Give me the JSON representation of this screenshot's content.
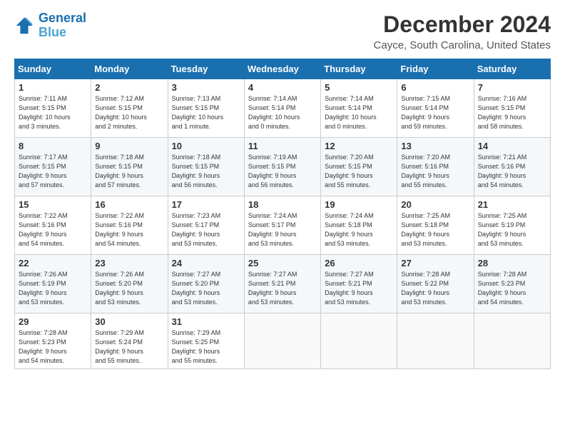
{
  "header": {
    "logo_line1": "General",
    "logo_line2": "Blue",
    "title": "December 2024",
    "subtitle": "Cayce, South Carolina, United States"
  },
  "days_of_week": [
    "Sunday",
    "Monday",
    "Tuesday",
    "Wednesday",
    "Thursday",
    "Friday",
    "Saturday"
  ],
  "weeks": [
    [
      {
        "day": "1",
        "lines": [
          "Sunrise: 7:11 AM",
          "Sunset: 5:15 PM",
          "Daylight: 10 hours",
          "and 3 minutes."
        ]
      },
      {
        "day": "2",
        "lines": [
          "Sunrise: 7:12 AM",
          "Sunset: 5:15 PM",
          "Daylight: 10 hours",
          "and 2 minutes."
        ]
      },
      {
        "day": "3",
        "lines": [
          "Sunrise: 7:13 AM",
          "Sunset: 5:15 PM",
          "Daylight: 10 hours",
          "and 1 minute."
        ]
      },
      {
        "day": "4",
        "lines": [
          "Sunrise: 7:14 AM",
          "Sunset: 5:14 PM",
          "Daylight: 10 hours",
          "and 0 minutes."
        ]
      },
      {
        "day": "5",
        "lines": [
          "Sunrise: 7:14 AM",
          "Sunset: 5:14 PM",
          "Daylight: 10 hours",
          "and 0 minutes."
        ]
      },
      {
        "day": "6",
        "lines": [
          "Sunrise: 7:15 AM",
          "Sunset: 5:14 PM",
          "Daylight: 9 hours",
          "and 59 minutes."
        ]
      },
      {
        "day": "7",
        "lines": [
          "Sunrise: 7:16 AM",
          "Sunset: 5:15 PM",
          "Daylight: 9 hours",
          "and 58 minutes."
        ]
      }
    ],
    [
      {
        "day": "8",
        "lines": [
          "Sunrise: 7:17 AM",
          "Sunset: 5:15 PM",
          "Daylight: 9 hours",
          "and 57 minutes."
        ]
      },
      {
        "day": "9",
        "lines": [
          "Sunrise: 7:18 AM",
          "Sunset: 5:15 PM",
          "Daylight: 9 hours",
          "and 57 minutes."
        ]
      },
      {
        "day": "10",
        "lines": [
          "Sunrise: 7:18 AM",
          "Sunset: 5:15 PM",
          "Daylight: 9 hours",
          "and 56 minutes."
        ]
      },
      {
        "day": "11",
        "lines": [
          "Sunrise: 7:19 AM",
          "Sunset: 5:15 PM",
          "Daylight: 9 hours",
          "and 56 minutes."
        ]
      },
      {
        "day": "12",
        "lines": [
          "Sunrise: 7:20 AM",
          "Sunset: 5:15 PM",
          "Daylight: 9 hours",
          "and 55 minutes."
        ]
      },
      {
        "day": "13",
        "lines": [
          "Sunrise: 7:20 AM",
          "Sunset: 5:16 PM",
          "Daylight: 9 hours",
          "and 55 minutes."
        ]
      },
      {
        "day": "14",
        "lines": [
          "Sunrise: 7:21 AM",
          "Sunset: 5:16 PM",
          "Daylight: 9 hours",
          "and 54 minutes."
        ]
      }
    ],
    [
      {
        "day": "15",
        "lines": [
          "Sunrise: 7:22 AM",
          "Sunset: 5:16 PM",
          "Daylight: 9 hours",
          "and 54 minutes."
        ]
      },
      {
        "day": "16",
        "lines": [
          "Sunrise: 7:22 AM",
          "Sunset: 5:16 PM",
          "Daylight: 9 hours",
          "and 54 minutes."
        ]
      },
      {
        "day": "17",
        "lines": [
          "Sunrise: 7:23 AM",
          "Sunset: 5:17 PM",
          "Daylight: 9 hours",
          "and 53 minutes."
        ]
      },
      {
        "day": "18",
        "lines": [
          "Sunrise: 7:24 AM",
          "Sunset: 5:17 PM",
          "Daylight: 9 hours",
          "and 53 minutes."
        ]
      },
      {
        "day": "19",
        "lines": [
          "Sunrise: 7:24 AM",
          "Sunset: 5:18 PM",
          "Daylight: 9 hours",
          "and 53 minutes."
        ]
      },
      {
        "day": "20",
        "lines": [
          "Sunrise: 7:25 AM",
          "Sunset: 5:18 PM",
          "Daylight: 9 hours",
          "and 53 minutes."
        ]
      },
      {
        "day": "21",
        "lines": [
          "Sunrise: 7:25 AM",
          "Sunset: 5:19 PM",
          "Daylight: 9 hours",
          "and 53 minutes."
        ]
      }
    ],
    [
      {
        "day": "22",
        "lines": [
          "Sunrise: 7:26 AM",
          "Sunset: 5:19 PM",
          "Daylight: 9 hours",
          "and 53 minutes."
        ]
      },
      {
        "day": "23",
        "lines": [
          "Sunrise: 7:26 AM",
          "Sunset: 5:20 PM",
          "Daylight: 9 hours",
          "and 53 minutes."
        ]
      },
      {
        "day": "24",
        "lines": [
          "Sunrise: 7:27 AM",
          "Sunset: 5:20 PM",
          "Daylight: 9 hours",
          "and 53 minutes."
        ]
      },
      {
        "day": "25",
        "lines": [
          "Sunrise: 7:27 AM",
          "Sunset: 5:21 PM",
          "Daylight: 9 hours",
          "and 53 minutes."
        ]
      },
      {
        "day": "26",
        "lines": [
          "Sunrise: 7:27 AM",
          "Sunset: 5:21 PM",
          "Daylight: 9 hours",
          "and 53 minutes."
        ]
      },
      {
        "day": "27",
        "lines": [
          "Sunrise: 7:28 AM",
          "Sunset: 5:22 PM",
          "Daylight: 9 hours",
          "and 53 minutes."
        ]
      },
      {
        "day": "28",
        "lines": [
          "Sunrise: 7:28 AM",
          "Sunset: 5:23 PM",
          "Daylight: 9 hours",
          "and 54 minutes."
        ]
      }
    ],
    [
      {
        "day": "29",
        "lines": [
          "Sunrise: 7:28 AM",
          "Sunset: 5:23 PM",
          "Daylight: 9 hours",
          "and 54 minutes."
        ]
      },
      {
        "day": "30",
        "lines": [
          "Sunrise: 7:29 AM",
          "Sunset: 5:24 PM",
          "Daylight: 9 hours",
          "and 55 minutes."
        ]
      },
      {
        "day": "31",
        "lines": [
          "Sunrise: 7:29 AM",
          "Sunset: 5:25 PM",
          "Daylight: 9 hours",
          "and 55 minutes."
        ]
      },
      {
        "day": "",
        "lines": []
      },
      {
        "day": "",
        "lines": []
      },
      {
        "day": "",
        "lines": []
      },
      {
        "day": "",
        "lines": []
      }
    ]
  ]
}
